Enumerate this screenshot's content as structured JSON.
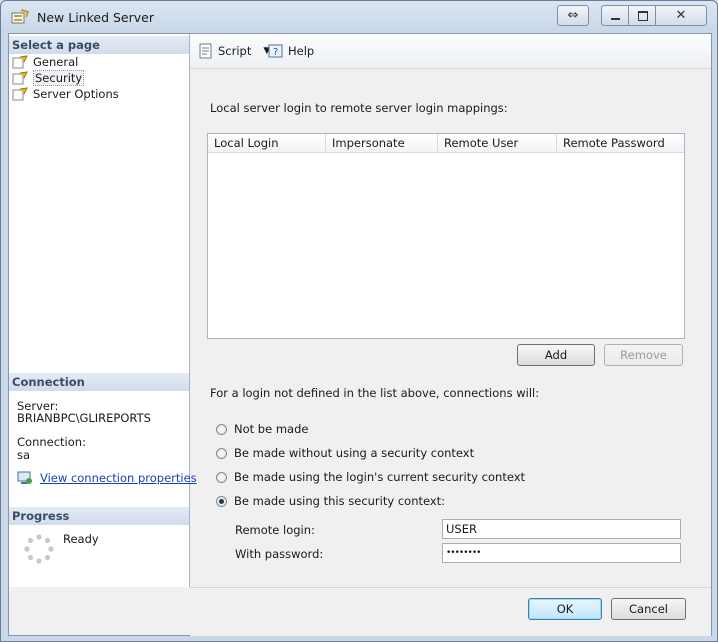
{
  "window": {
    "title": "New Linked Server"
  },
  "left": {
    "select_page_header": "Select a page",
    "pages": [
      {
        "label": "General"
      },
      {
        "label": "Security"
      },
      {
        "label": "Server Options"
      }
    ],
    "connection_header": "Connection",
    "server_label": "Server:",
    "server_value": "BRIANBPC\\GLIREPORTS",
    "connection_label": "Connection:",
    "connection_value": "sa",
    "view_props_link": "View connection properties",
    "progress_header": "Progress",
    "progress_status": "Ready"
  },
  "toolbar": {
    "script_label": "Script",
    "help_label": "Help"
  },
  "security": {
    "mappings_label": "Local server login to remote server login mappings:",
    "columns": [
      "Local Login",
      "Impersonate",
      "Remote User",
      "Remote Password"
    ],
    "add_label": "Add",
    "remove_label": "Remove",
    "not_defined_label": "For a login not defined in the list above, connections will:",
    "options": [
      {
        "label": "Not be made",
        "checked": false
      },
      {
        "label": "Be made without using a security context",
        "checked": false
      },
      {
        "label": "Be made using the login's current security context",
        "checked": false
      },
      {
        "label": "Be made using this security context:",
        "checked": true
      }
    ],
    "remote_login_label": "Remote login:",
    "remote_login_value": "USER",
    "password_label": "With password:",
    "password_value": "••••••••"
  },
  "footer": {
    "ok_label": "OK",
    "cancel_label": "Cancel"
  }
}
